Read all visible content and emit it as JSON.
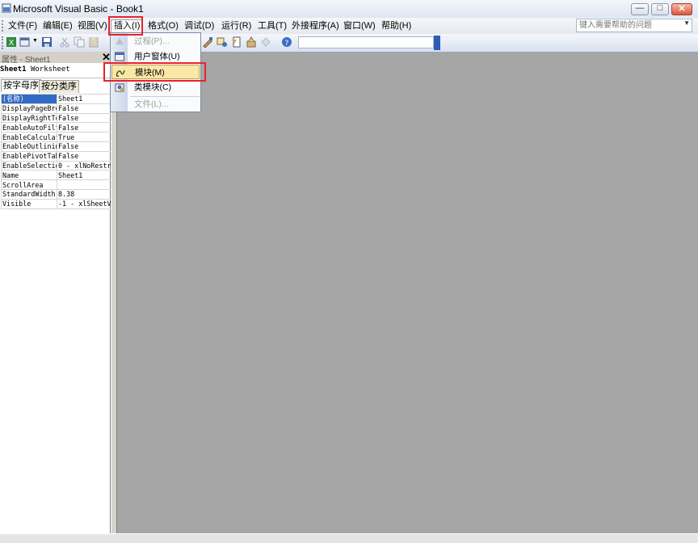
{
  "window": {
    "title": "Microsoft Visual Basic - Book1",
    "minimize_label": "—",
    "maximize_label": "□",
    "close_label": "✕"
  },
  "menubar": {
    "items": [
      "文件(F)",
      "编辑(E)",
      "视图(V)",
      "插入(I)",
      "格式(O)",
      "调试(D)",
      "运行(R)",
      "工具(T)",
      "外接程序(A)",
      "窗口(W)",
      "帮助(H)"
    ],
    "active_item": "插入(I)",
    "help_placeholder": "键入需要帮助的问题"
  },
  "insert_menu": {
    "items": [
      {
        "label": "过程(P)...",
        "icon": "procedure-icon",
        "enabled": false
      },
      {
        "label": "用户窗体(U)",
        "icon": "userform-icon",
        "enabled": true
      },
      {
        "label": "模块(M)",
        "icon": "module-icon",
        "enabled": true,
        "highlighted": true
      },
      {
        "label": "类模块(C)",
        "icon": "class-module-icon",
        "enabled": true
      },
      {
        "label": "文件(L)...",
        "icon": "",
        "enabled": false
      }
    ]
  },
  "properties_pane": {
    "title": "属性 - Sheet1",
    "close_label": "✕",
    "object_name": "Sheet1",
    "object_type": "Worksheet",
    "tabs": [
      "按字母序",
      "按分类序"
    ],
    "rows": [
      {
        "name": "(名称)",
        "value": "Sheet1"
      },
      {
        "name": "DisplayPageBre",
        "value": "False"
      },
      {
        "name": "DisplayRightTo",
        "value": "False"
      },
      {
        "name": "EnableAutoFilt",
        "value": "False"
      },
      {
        "name": "EnableCalculat",
        "value": "True"
      },
      {
        "name": "EnableOutlinin",
        "value": "False"
      },
      {
        "name": "EnablePivotTab",
        "value": "False"
      },
      {
        "name": "EnableSelectio",
        "value": "0 - xlNoRestr"
      },
      {
        "name": "Name",
        "value": "Sheet1"
      },
      {
        "name": "ScrollArea",
        "value": ""
      },
      {
        "name": "StandardWidth",
        "value": "8.38"
      },
      {
        "name": "Visible",
        "value": "-1 - xlSheetV"
      }
    ]
  },
  "colors": {
    "highlight_box": "#e8232a",
    "menu_hover": "#fbe7a6",
    "workspace": "#a6a6a6"
  }
}
